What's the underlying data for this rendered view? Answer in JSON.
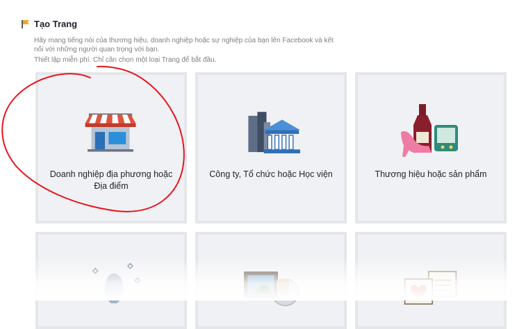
{
  "header": {
    "title": "Tạo Trang",
    "description": "Hãy mang tiếng nói của thương hiệu, doanh nghiệp hoặc sự nghiệp của bạn lên Facebook và kết nối với những người quan trọng với bạn.",
    "instruction": "Thiết lập miễn phí. Chỉ cần chọn một loại Trang để bắt đầu."
  },
  "categories": [
    {
      "label": "Doanh nghiệp địa phương hoặc Địa điểm",
      "icon": "storefront-icon"
    },
    {
      "label": "Công ty, Tổ chức hoặc Học viện",
      "icon": "building-icon"
    },
    {
      "label": "Thương hiệu hoặc sản phẩm",
      "icon": "products-icon"
    },
    {
      "label": "",
      "icon": "public-figure-icon"
    },
    {
      "label": "",
      "icon": "entertainment-icon"
    },
    {
      "label": "",
      "icon": "cause-icon"
    }
  ],
  "annotation": {
    "color": "#e8141b"
  }
}
